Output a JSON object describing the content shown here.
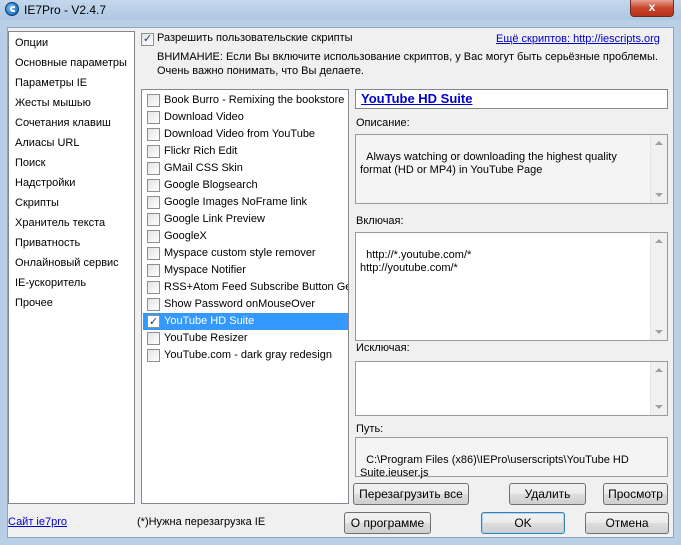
{
  "window": {
    "title": "IE7Pro - V2.4.7",
    "close_glyph": "x"
  },
  "sidebar": {
    "items": [
      {
        "label": "Опции"
      },
      {
        "label": "Основные параметры"
      },
      {
        "label": "Параметры IE"
      },
      {
        "label": "Жесты мышью"
      },
      {
        "label": "Сочетания клавиш"
      },
      {
        "label": "Алиасы URL"
      },
      {
        "label": "Поиск"
      },
      {
        "label": "Надстройки"
      },
      {
        "label": "Скрипты"
      },
      {
        "label": "Хранитель текста"
      },
      {
        "label": "Приватность"
      },
      {
        "label": "Онлайновый сервис"
      },
      {
        "label": "IE-ускоритель"
      },
      {
        "label": "Прочее"
      }
    ],
    "selected": "Скрипты"
  },
  "header": {
    "enable_label": "Разрешить пользовательские скрипты",
    "enable_checked": true,
    "more_link": "Ещё скриптов: http://iescripts.org",
    "warning_line1": "ВНИМАНИЕ: Если Вы включите использование скриптов, у Вас могут быть серьёзные проблемы.",
    "warning_line2": "Очень важно понимать, что Вы делаете."
  },
  "scripts": [
    {
      "label": "Book Burro - Remixing the bookstore",
      "checked": false
    },
    {
      "label": "Download Video",
      "checked": false
    },
    {
      "label": "Download Video from YouTube",
      "checked": false
    },
    {
      "label": "Flickr Rich Edit",
      "checked": false
    },
    {
      "label": "GMail CSS Skin",
      "checked": false
    },
    {
      "label": "Google Blogsearch",
      "checked": false
    },
    {
      "label": "Google Images NoFrame link",
      "checked": false
    },
    {
      "label": "Google Link Preview",
      "checked": false
    },
    {
      "label": "GoogleX",
      "checked": false
    },
    {
      "label": "Myspace custom style remover",
      "checked": false
    },
    {
      "label": "Myspace Notifier",
      "checked": false
    },
    {
      "label": "RSS+Atom Feed Subscribe Button Generator",
      "checked": false
    },
    {
      "label": "Show Password onMouseOver",
      "checked": false
    },
    {
      "label": "YouTube HD Suite",
      "checked": true,
      "selected": true
    },
    {
      "label": "YouTube Resizer",
      "checked": false
    },
    {
      "label": "YouTube.com - dark gray redesign",
      "checked": false
    }
  ],
  "detail": {
    "title": "YouTube HD Suite",
    "description_label": "Описание:",
    "description": "Always watching or downloading the highest quality format (HD or MP4) in YouTube Page",
    "include_label": "Включая:",
    "include": "http://*.youtube.com/*\nhttp://youtube.com/*",
    "exclude_label": "Исключая:",
    "exclude": "",
    "path_label": "Путь:",
    "path": "C:\\Program Files (x86)\\IEPro\\userscripts\\YouTube HD Suite.ieuser.js"
  },
  "actions": {
    "reload_all": "Перезагрузить все",
    "delete": "Удалить",
    "view": "Просмотр"
  },
  "footer": {
    "site_link": "Сайт ie7pro",
    "note": "(*)Нужна перезагрузка IE",
    "about": "О программе",
    "ok": "OK",
    "cancel": "Отмена"
  },
  "colors": {
    "selection": "#3399ff",
    "link": "#0000cc",
    "frame": "#b8cfe6"
  }
}
